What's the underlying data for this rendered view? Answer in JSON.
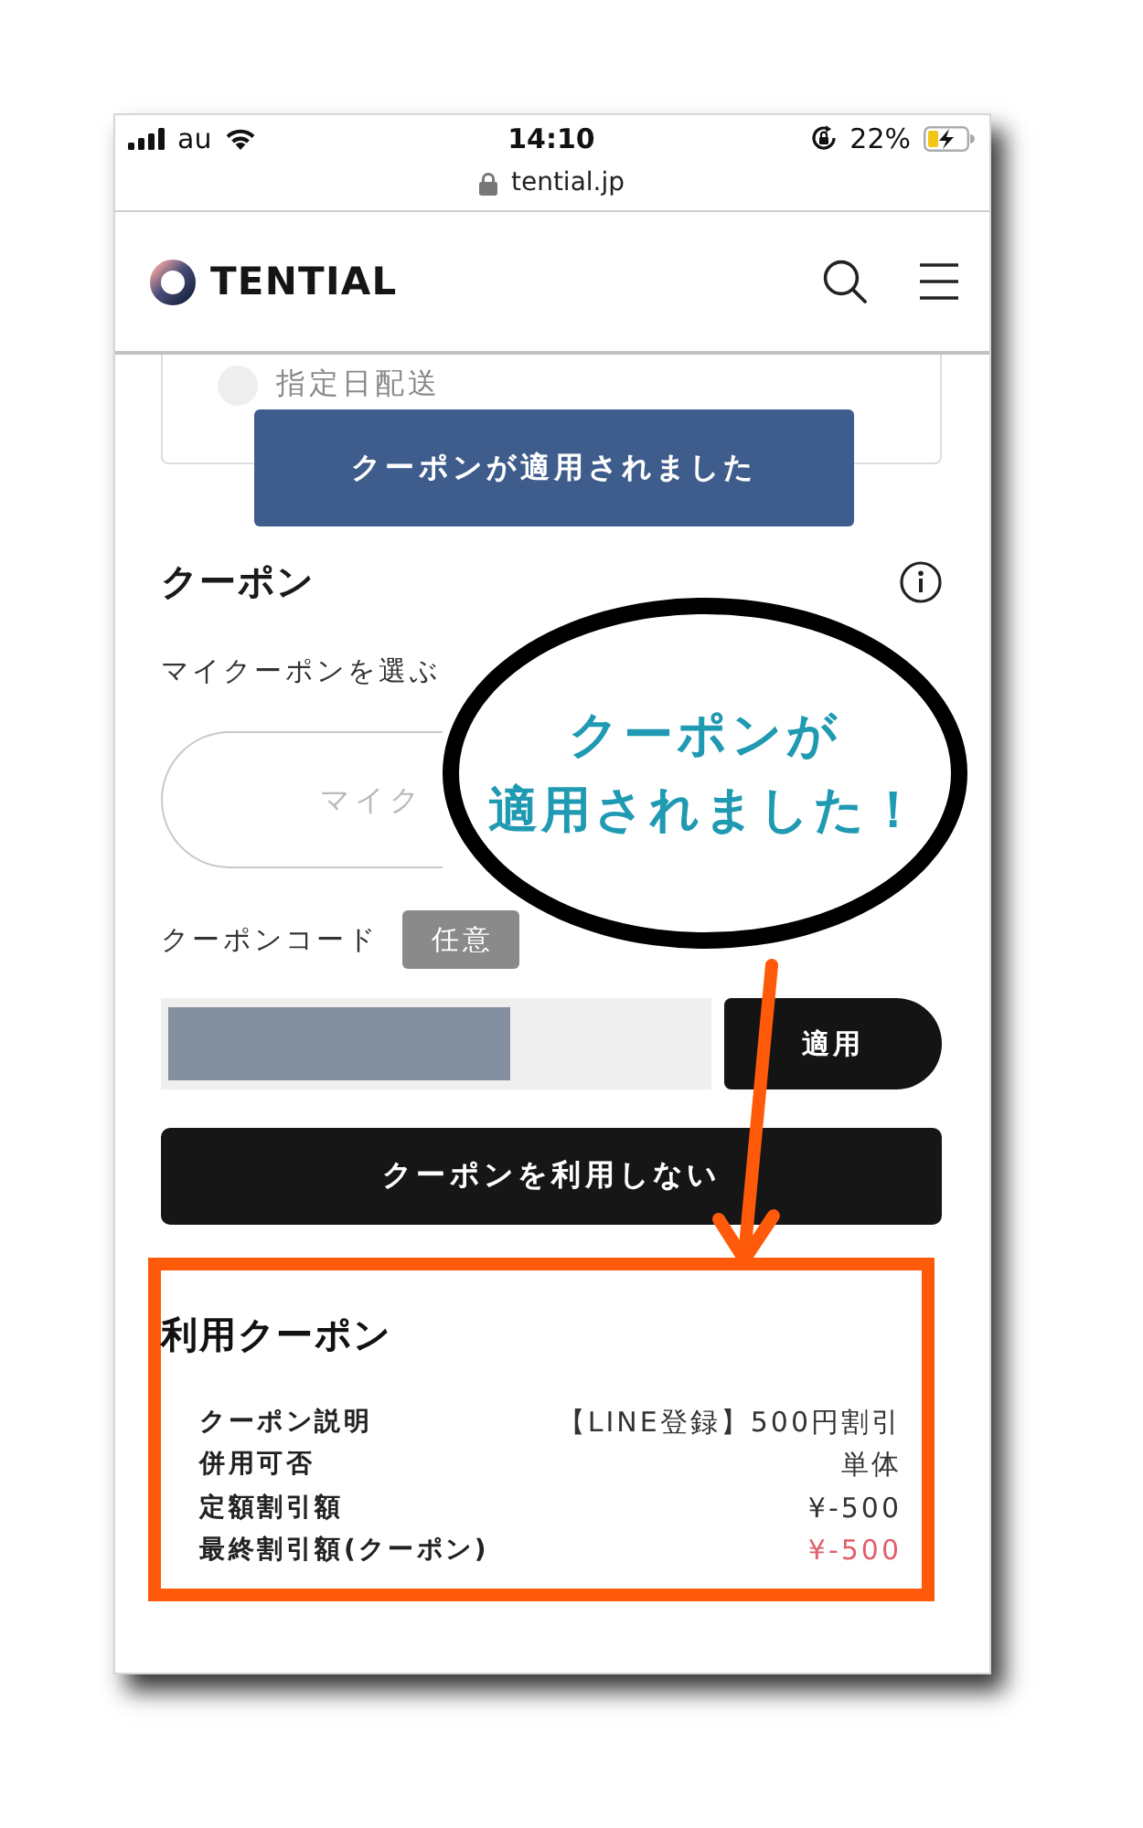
{
  "status_bar": {
    "carrier": "au",
    "time": "14:10",
    "battery": "22%"
  },
  "address_bar": {
    "url": "tential.jp"
  },
  "header": {
    "logo": "TENTIAL"
  },
  "delivery_option": {
    "label": "指定日配送",
    "selected": false
  },
  "toast": {
    "message": "クーポンが適用されました"
  },
  "coupon": {
    "title": "クーポン",
    "my_coupon_label": "マイクーポンを選ぶ",
    "my_coupon_select": {
      "placeholder": "マイク"
    },
    "code_label": "クーポンコード",
    "code_badge": "任意",
    "code_field": {
      "redacted": true
    },
    "apply_button": "適用",
    "no_coupon_button": "クーポンを利用しない"
  },
  "callout": {
    "lines": [
      "クーポンが",
      "適用されました！"
    ]
  },
  "applied_coupon": {
    "title": "利用クーポン",
    "rows": [
      {
        "label": "クーポン説明",
        "value": "【LINE登録】500円割引",
        "highlight": false
      },
      {
        "label": "併用可否",
        "value": "単体",
        "highlight": false
      },
      {
        "label": "定額割引額",
        "value": "¥-500",
        "highlight": false
      },
      {
        "label": "最終割引額(クーポン)",
        "value": "¥-500",
        "highlight": true
      }
    ]
  }
}
